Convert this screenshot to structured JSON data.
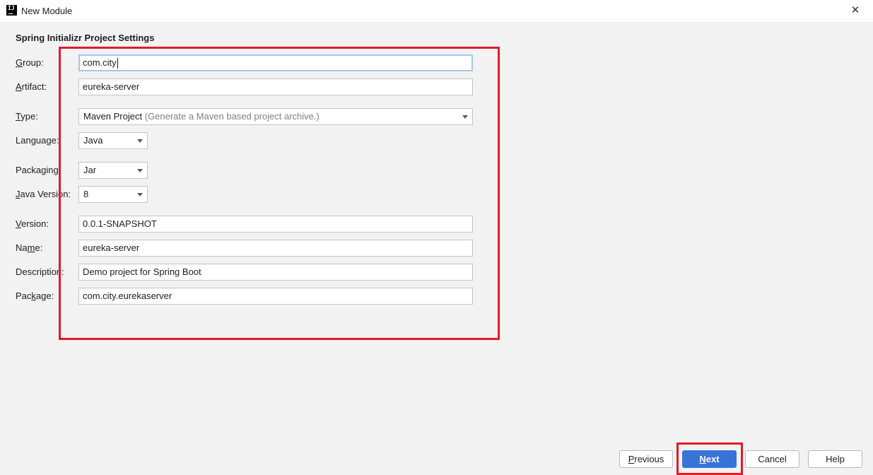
{
  "window": {
    "icon_text": "IJ",
    "title": "New Module",
    "close_label": "✕"
  },
  "section_title": "Spring Initializr Project Settings",
  "fields": {
    "group": {
      "mnemonic": "G",
      "label_rest": "roup:",
      "value": "com.city"
    },
    "artifact": {
      "mnemonic": "A",
      "label_rest": "rtifact:",
      "value": "eureka-server"
    },
    "type": {
      "mnemonic": "T",
      "label_rest": "ype:",
      "value": "Maven Project",
      "hint": "(Generate a Maven based project archive.)"
    },
    "language": {
      "label": "Language:",
      "value": "Java"
    },
    "packaging": {
      "label": "Packaging:",
      "value": "Jar"
    },
    "java_version": {
      "mnemonic": "J",
      "label_rest": "ava Version:",
      "value": "8"
    },
    "version": {
      "mnemonic": "V",
      "label_rest": "ersion:",
      "value": "0.0.1-SNAPSHOT"
    },
    "name": {
      "label_start": "Na",
      "mnemonic": "m",
      "label_rest": "e:",
      "value": "eureka-server"
    },
    "description": {
      "label": "Description:",
      "value": "Demo project for Spring Boot"
    },
    "package": {
      "label_start": "Pac",
      "mnemonic": "k",
      "label_rest": "age:",
      "value": "com.city.eurekaserver"
    }
  },
  "buttons": {
    "previous": {
      "mnemonic": "P",
      "label_rest": "revious"
    },
    "next": {
      "mnemonic": "N",
      "label_rest": "ext"
    },
    "cancel": "Cancel",
    "help": "Help"
  },
  "colors": {
    "primary_button": "#3874d8",
    "annotation_red": "#e01b2a",
    "focus_border": "#a7c6ec",
    "background": "#f2f2f2"
  }
}
